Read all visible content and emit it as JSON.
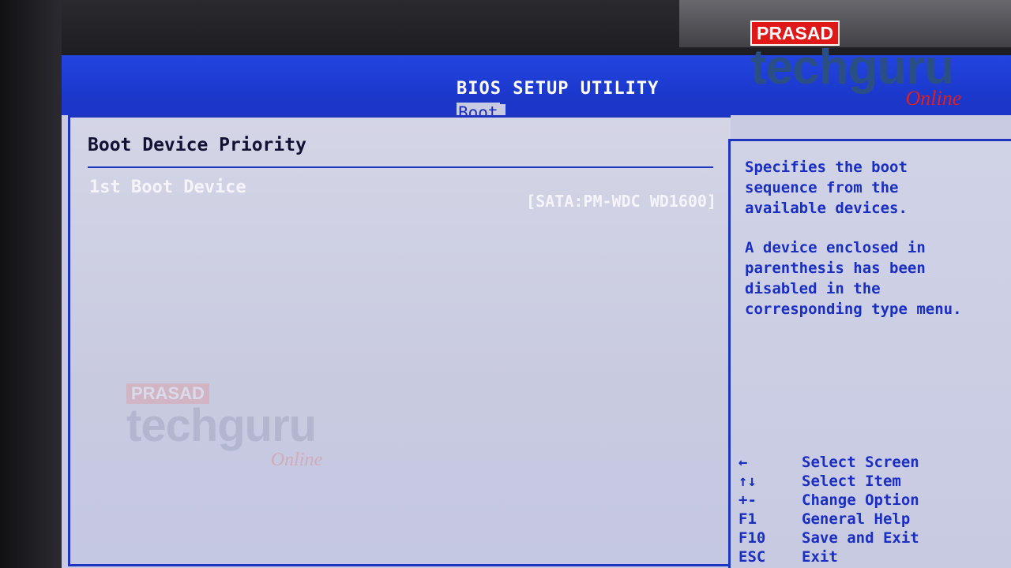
{
  "header": {
    "title": "BIOS SETUP UTILITY",
    "active_tab": "Boot"
  },
  "main": {
    "section_title": "Boot Device Priority",
    "items": [
      {
        "label": "1st Boot Device",
        "value": "[SATA:PM-WDC WD1600]"
      }
    ]
  },
  "help": {
    "paragraph1": "Specifies the boot sequence from the available devices.",
    "paragraph2": "A device enclosed in parenthesis has been disabled in the corresponding type menu."
  },
  "keys": [
    {
      "key": "←",
      "desc": "Select Screen",
      "icon": "arrow-left-icon"
    },
    {
      "key": "↑↓",
      "desc": "Select Item",
      "icon": "arrow-up-down-icon"
    },
    {
      "key": "+-",
      "desc": "Change Option",
      "icon": "plus-minus-icon"
    },
    {
      "key": "F1",
      "desc": "General Help"
    },
    {
      "key": "F10",
      "desc": "Save and Exit"
    },
    {
      "key": "ESC",
      "desc": "Exit"
    }
  ],
  "watermark": {
    "badge": "PRASAD",
    "brand": "techguru",
    "tagline": "Online"
  },
  "colors": {
    "header_blue": "#1b36c8",
    "screen_bg": "#c9cbe2",
    "help_text": "#1a2fc0",
    "badge_red": "#e01818"
  }
}
